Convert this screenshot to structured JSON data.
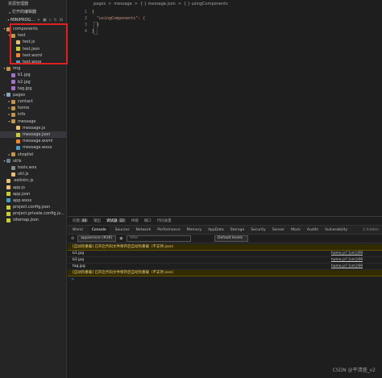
{
  "sidebar": {
    "title": "资源管理器",
    "open_editors": "打开的编辑器",
    "project": "MINIPROG...",
    "tree": [
      {
        "label": "components",
        "depth": 0,
        "type": "folder",
        "expanded": true
      },
      {
        "label": "test",
        "depth": 1,
        "type": "folder",
        "expanded": true
      },
      {
        "label": "test.js",
        "depth": 2,
        "type": "js"
      },
      {
        "label": "test.json",
        "depth": 2,
        "type": "json"
      },
      {
        "label": "test.wxml",
        "depth": 2,
        "type": "wxml"
      },
      {
        "label": "test.wxss",
        "depth": 2,
        "type": "wxss"
      },
      {
        "label": "img",
        "depth": 0,
        "type": "folder",
        "expanded": true
      },
      {
        "label": "b1.jpg",
        "depth": 1,
        "type": "jpg"
      },
      {
        "label": "b2.jpg",
        "depth": 1,
        "type": "jpg"
      },
      {
        "label": "tag.jpg",
        "depth": 1,
        "type": "jpg"
      },
      {
        "label": "pages",
        "depth": 0,
        "type": "folder-pages",
        "expanded": true
      },
      {
        "label": "contact",
        "depth": 1,
        "type": "folder",
        "expanded": false
      },
      {
        "label": "home",
        "depth": 1,
        "type": "folder",
        "expanded": false
      },
      {
        "label": "info",
        "depth": 1,
        "type": "folder",
        "expanded": false
      },
      {
        "label": "message",
        "depth": 1,
        "type": "folder",
        "expanded": true
      },
      {
        "label": "message.js",
        "depth": 2,
        "type": "js"
      },
      {
        "label": "message.json",
        "depth": 2,
        "type": "json",
        "selected": true
      },
      {
        "label": "message.wxml",
        "depth": 2,
        "type": "wxml"
      },
      {
        "label": "message.wxss",
        "depth": 2,
        "type": "wxss"
      },
      {
        "label": "shoplist",
        "depth": 1,
        "type": "folder",
        "expanded": false
      },
      {
        "label": "utils",
        "depth": 0,
        "type": "folder-utils",
        "expanded": true
      },
      {
        "label": "tools.wxs",
        "depth": 1,
        "type": "file"
      },
      {
        "label": "util.js",
        "depth": 1,
        "type": "js"
      },
      {
        "label": ".eslintrc.js",
        "depth": 0,
        "type": "js"
      },
      {
        "label": "app.js",
        "depth": 0,
        "type": "js"
      },
      {
        "label": "app.json",
        "depth": 0,
        "type": "json"
      },
      {
        "label": "app.wxss",
        "depth": 0,
        "type": "wxss"
      },
      {
        "label": "project.config.json",
        "depth": 0,
        "type": "json"
      },
      {
        "label": "project.private.config.js...",
        "depth": 0,
        "type": "json"
      },
      {
        "label": "sitemap.json",
        "depth": 0,
        "type": "json"
      }
    ]
  },
  "editor": {
    "breadcrumb": [
      "pages",
      ">",
      "message",
      ">",
      "{ } message.json",
      ">",
      "{ } usingComponents"
    ],
    "line_numbers": [
      "1",
      "2",
      "3",
      "4"
    ],
    "lines": [
      {
        "text": "{",
        "kind": "brace"
      },
      {
        "text": "  \"usingComponents\": {",
        "kind": "key"
      },
      {
        "text": "  }",
        "kind": "brace"
      },
      {
        "text": "}",
        "kind": "brace"
      }
    ]
  },
  "devtools": {
    "top_tabs": [
      {
        "label": "问题",
        "active": false
      },
      {
        "label": "输出",
        "active": false
      },
      {
        "label": "调试器",
        "active": true
      },
      {
        "label": "终端",
        "active": false
      },
      {
        "label": "端口",
        "active": false
      },
      {
        "label": "代码质量",
        "active": false
      }
    ],
    "top_tab_badges": {
      "问题": "48",
      "调试器": "23"
    },
    "panel_tabs": [
      {
        "label": "Wxml",
        "active": false
      },
      {
        "label": "Console",
        "active": true
      },
      {
        "label": "Sources",
        "active": false
      },
      {
        "label": "Network",
        "active": false
      },
      {
        "label": "Performance",
        "active": false
      },
      {
        "label": "Memory",
        "active": false
      },
      {
        "label": "AppData",
        "active": false
      },
      {
        "label": "Storage",
        "active": false
      },
      {
        "label": "Security",
        "active": false
      },
      {
        "label": "Sensor",
        "active": false
      },
      {
        "label": "Mock",
        "active": false
      },
      {
        "label": "Audits",
        "active": false
      },
      {
        "label": "Vulnerability",
        "active": false
      }
    ],
    "hidden_count": "2 hidden",
    "context_select": "appservice (#26)",
    "filter_placeholder": "Filter",
    "levels_select": "Default levels",
    "logs": [
      {
        "text": "[自动热重载] 已开启代码文件保存后自动热重载（不支持 json）",
        "warn": true,
        "src": ""
      },
      {
        "text": "b1.jpg",
        "warn": false,
        "src": "home.js? [sm]:69"
      },
      {
        "text": "b2.jpg",
        "warn": false,
        "src": "home.js? [sm]:69"
      },
      {
        "text": "tag.jpg",
        "warn": false,
        "src": "home.js? [sm]:69"
      },
      {
        "text": "[自动热重载] 已开启代码文件保存后自动热重载（不支持 json）",
        "warn": true,
        "src": ""
      }
    ],
    "prompt": ">"
  },
  "watermark": "CSDN @平清盛_v2"
}
